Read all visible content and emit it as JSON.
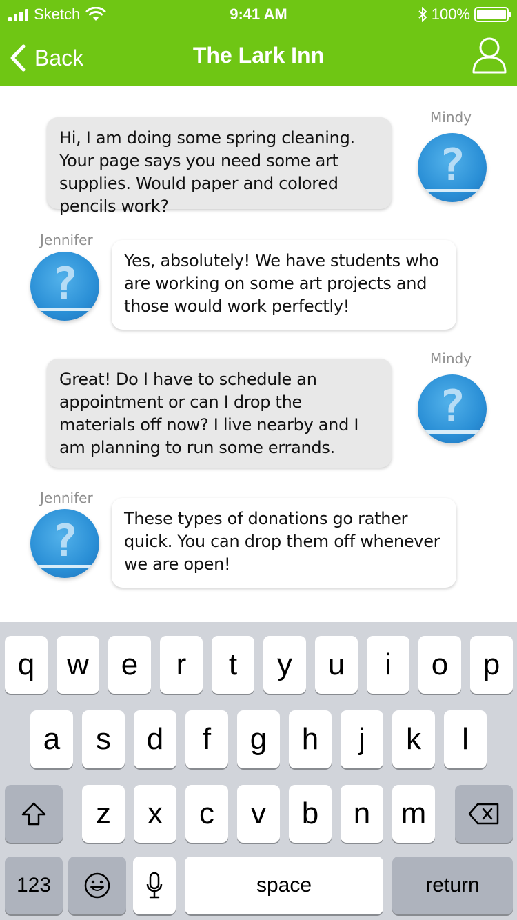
{
  "status_bar": {
    "carrier": "Sketch",
    "time": "9:41 AM",
    "battery": "100%"
  },
  "nav": {
    "back_label": "Back",
    "title": "The Lark Inn",
    "profile_icon": "user-icon"
  },
  "messages": [
    {
      "sender": "Mindy",
      "side": "right",
      "text": "Hi, I am doing some spring cleaning. Your page says you need some art supplies. Would paper and colored pencils work?"
    },
    {
      "sender": "Jennifer",
      "side": "left",
      "text": "Yes, absolutely! We have students who are working on some art projects and those would work perfectly!"
    },
    {
      "sender": "Mindy",
      "side": "right",
      "text": "Great! Do I have to schedule an appointment or can I drop the materials off now? I live nearby and I am planning to run some errands."
    },
    {
      "sender": "Jennifer",
      "side": "left",
      "text": "These types of donations go rather quick. You can drop them off whenever we are open!"
    }
  ],
  "keyboard": {
    "row1": [
      "q",
      "w",
      "e",
      "r",
      "t",
      "y",
      "u",
      "i",
      "o",
      "p"
    ],
    "row2": [
      "a",
      "s",
      "d",
      "f",
      "g",
      "h",
      "j",
      "k",
      "l"
    ],
    "row3": [
      "z",
      "x",
      "c",
      "v",
      "b",
      "n",
      "m"
    ],
    "numbers_label": "123",
    "space_label": "space",
    "return_label": "return"
  },
  "colors": {
    "accent": "#6fc614",
    "bubble_gray": "#e8e8e8",
    "keyboard_bg": "#d1d4da"
  }
}
